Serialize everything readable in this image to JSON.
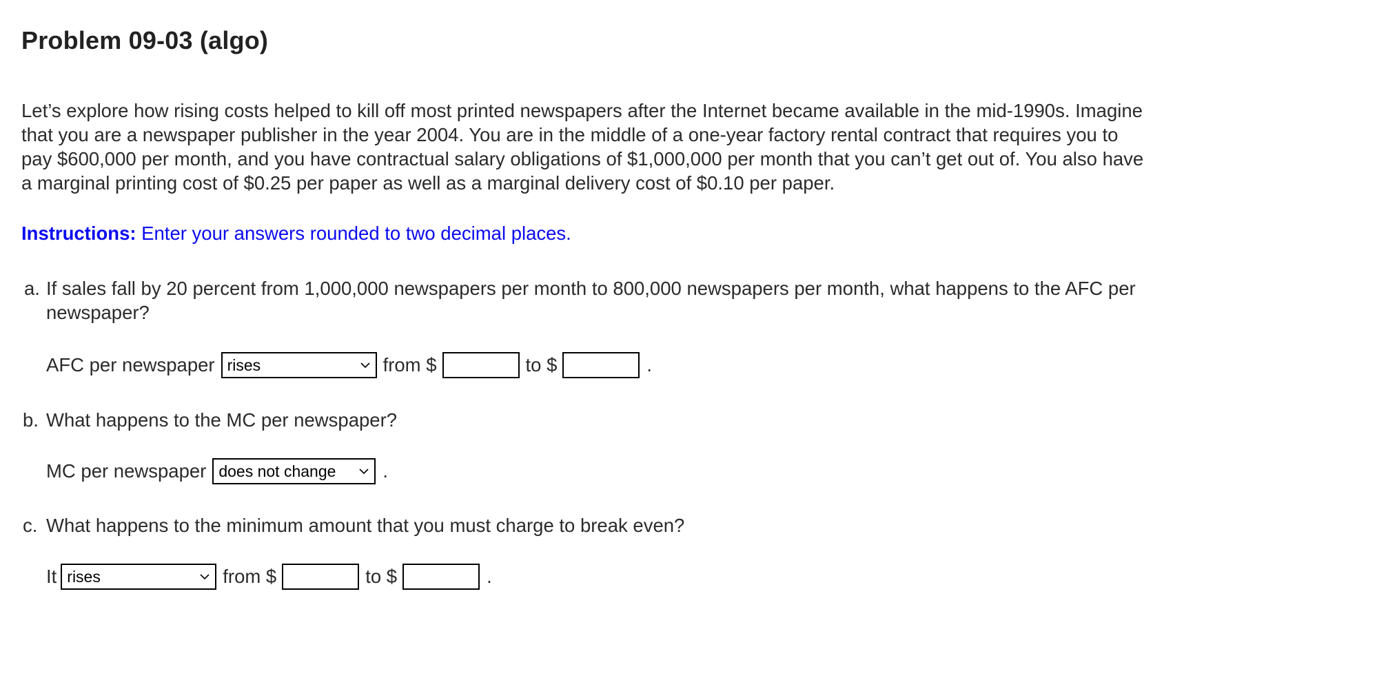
{
  "title": "Problem 09-03 (algo)",
  "intro_lines": [
    "Let’s explore how rising costs helped to kill off most printed newspapers after the Internet became available in the mid-1990s. Imagine",
    "that you are a newspaper publisher in the year 2004. You are in the middle of a one-year factory rental contract that requires you to",
    "pay $600,000 per month, and you have contractual salary obligations of $1,000,000 per month that you can’t get out of. You also have",
    "a marginal printing cost of $0.25 per paper as well as a marginal delivery cost of $0.10 per paper."
  ],
  "instructions": {
    "label": "Instructions:",
    "text": " Enter your answers rounded to two decimal places.",
    "color": "#0a0af0"
  },
  "questions": {
    "a": {
      "marker": "a.",
      "lines": [
        "If sales fall by 20 percent from 1,000,000 newspapers per month to 800,000 newspapers per month, what happens to the AFC per",
        "newspaper?"
      ],
      "answer_label": "AFC per newspaper",
      "select_value": "rises",
      "from_label": "from $",
      "from_value": "",
      "to_label": "to $",
      "to_value": "",
      "end": "."
    },
    "b": {
      "marker": "b.",
      "text": "What happens to the MC per newspaper?",
      "answer_label": "MC per newspaper",
      "select_value": "does not change",
      "end": "."
    },
    "c": {
      "marker": "c.",
      "text": "What happens to the minimum amount that you must charge to break even?",
      "answer_label": "It",
      "select_value": "rises",
      "from_label": "from $",
      "from_value": "",
      "to_label": "to $",
      "to_value": "",
      "end": "."
    }
  },
  "icons": {
    "dropdown": "chevron-down-icon"
  }
}
